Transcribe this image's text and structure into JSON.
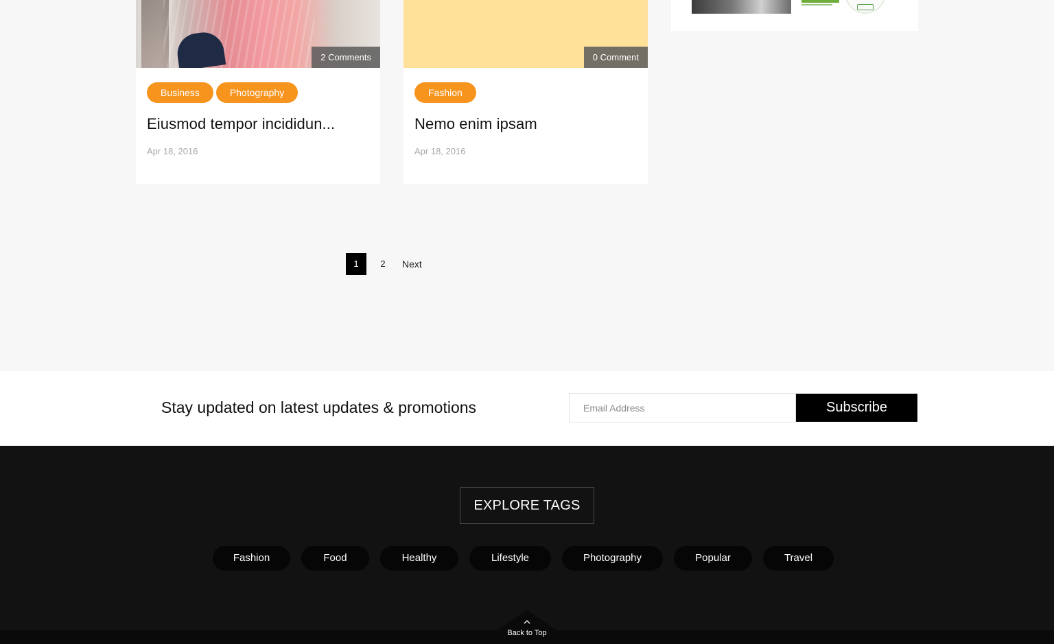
{
  "posts": [
    {
      "comments": "2 Comments",
      "categories": [
        "Business",
        "Photography"
      ],
      "title": "Eiusmod tempor incididun...",
      "date": "Apr 18, 2016"
    },
    {
      "comments": "0 Comment",
      "categories": [
        "Fashion"
      ],
      "title": "Nemo enim ipsam",
      "date": "Apr 18, 2016"
    }
  ],
  "pagination": {
    "current": "1",
    "page2": "2",
    "next": "Next"
  },
  "newsletter": {
    "text": "Stay updated on latest updates & promotions",
    "placeholder": "Email Address",
    "button": "Subscribe"
  },
  "footer": {
    "heading": "EXPLORE TAGS",
    "tags": [
      "Fashion",
      "Food",
      "Healthy",
      "Lifestyle",
      "Photography",
      "Popular",
      "Travel"
    ],
    "back_to_top": "Back to Top"
  },
  "colors": {
    "accent": "#f7941d",
    "footer_bg": "#121212",
    "page_bg": "#f7f7f7"
  }
}
